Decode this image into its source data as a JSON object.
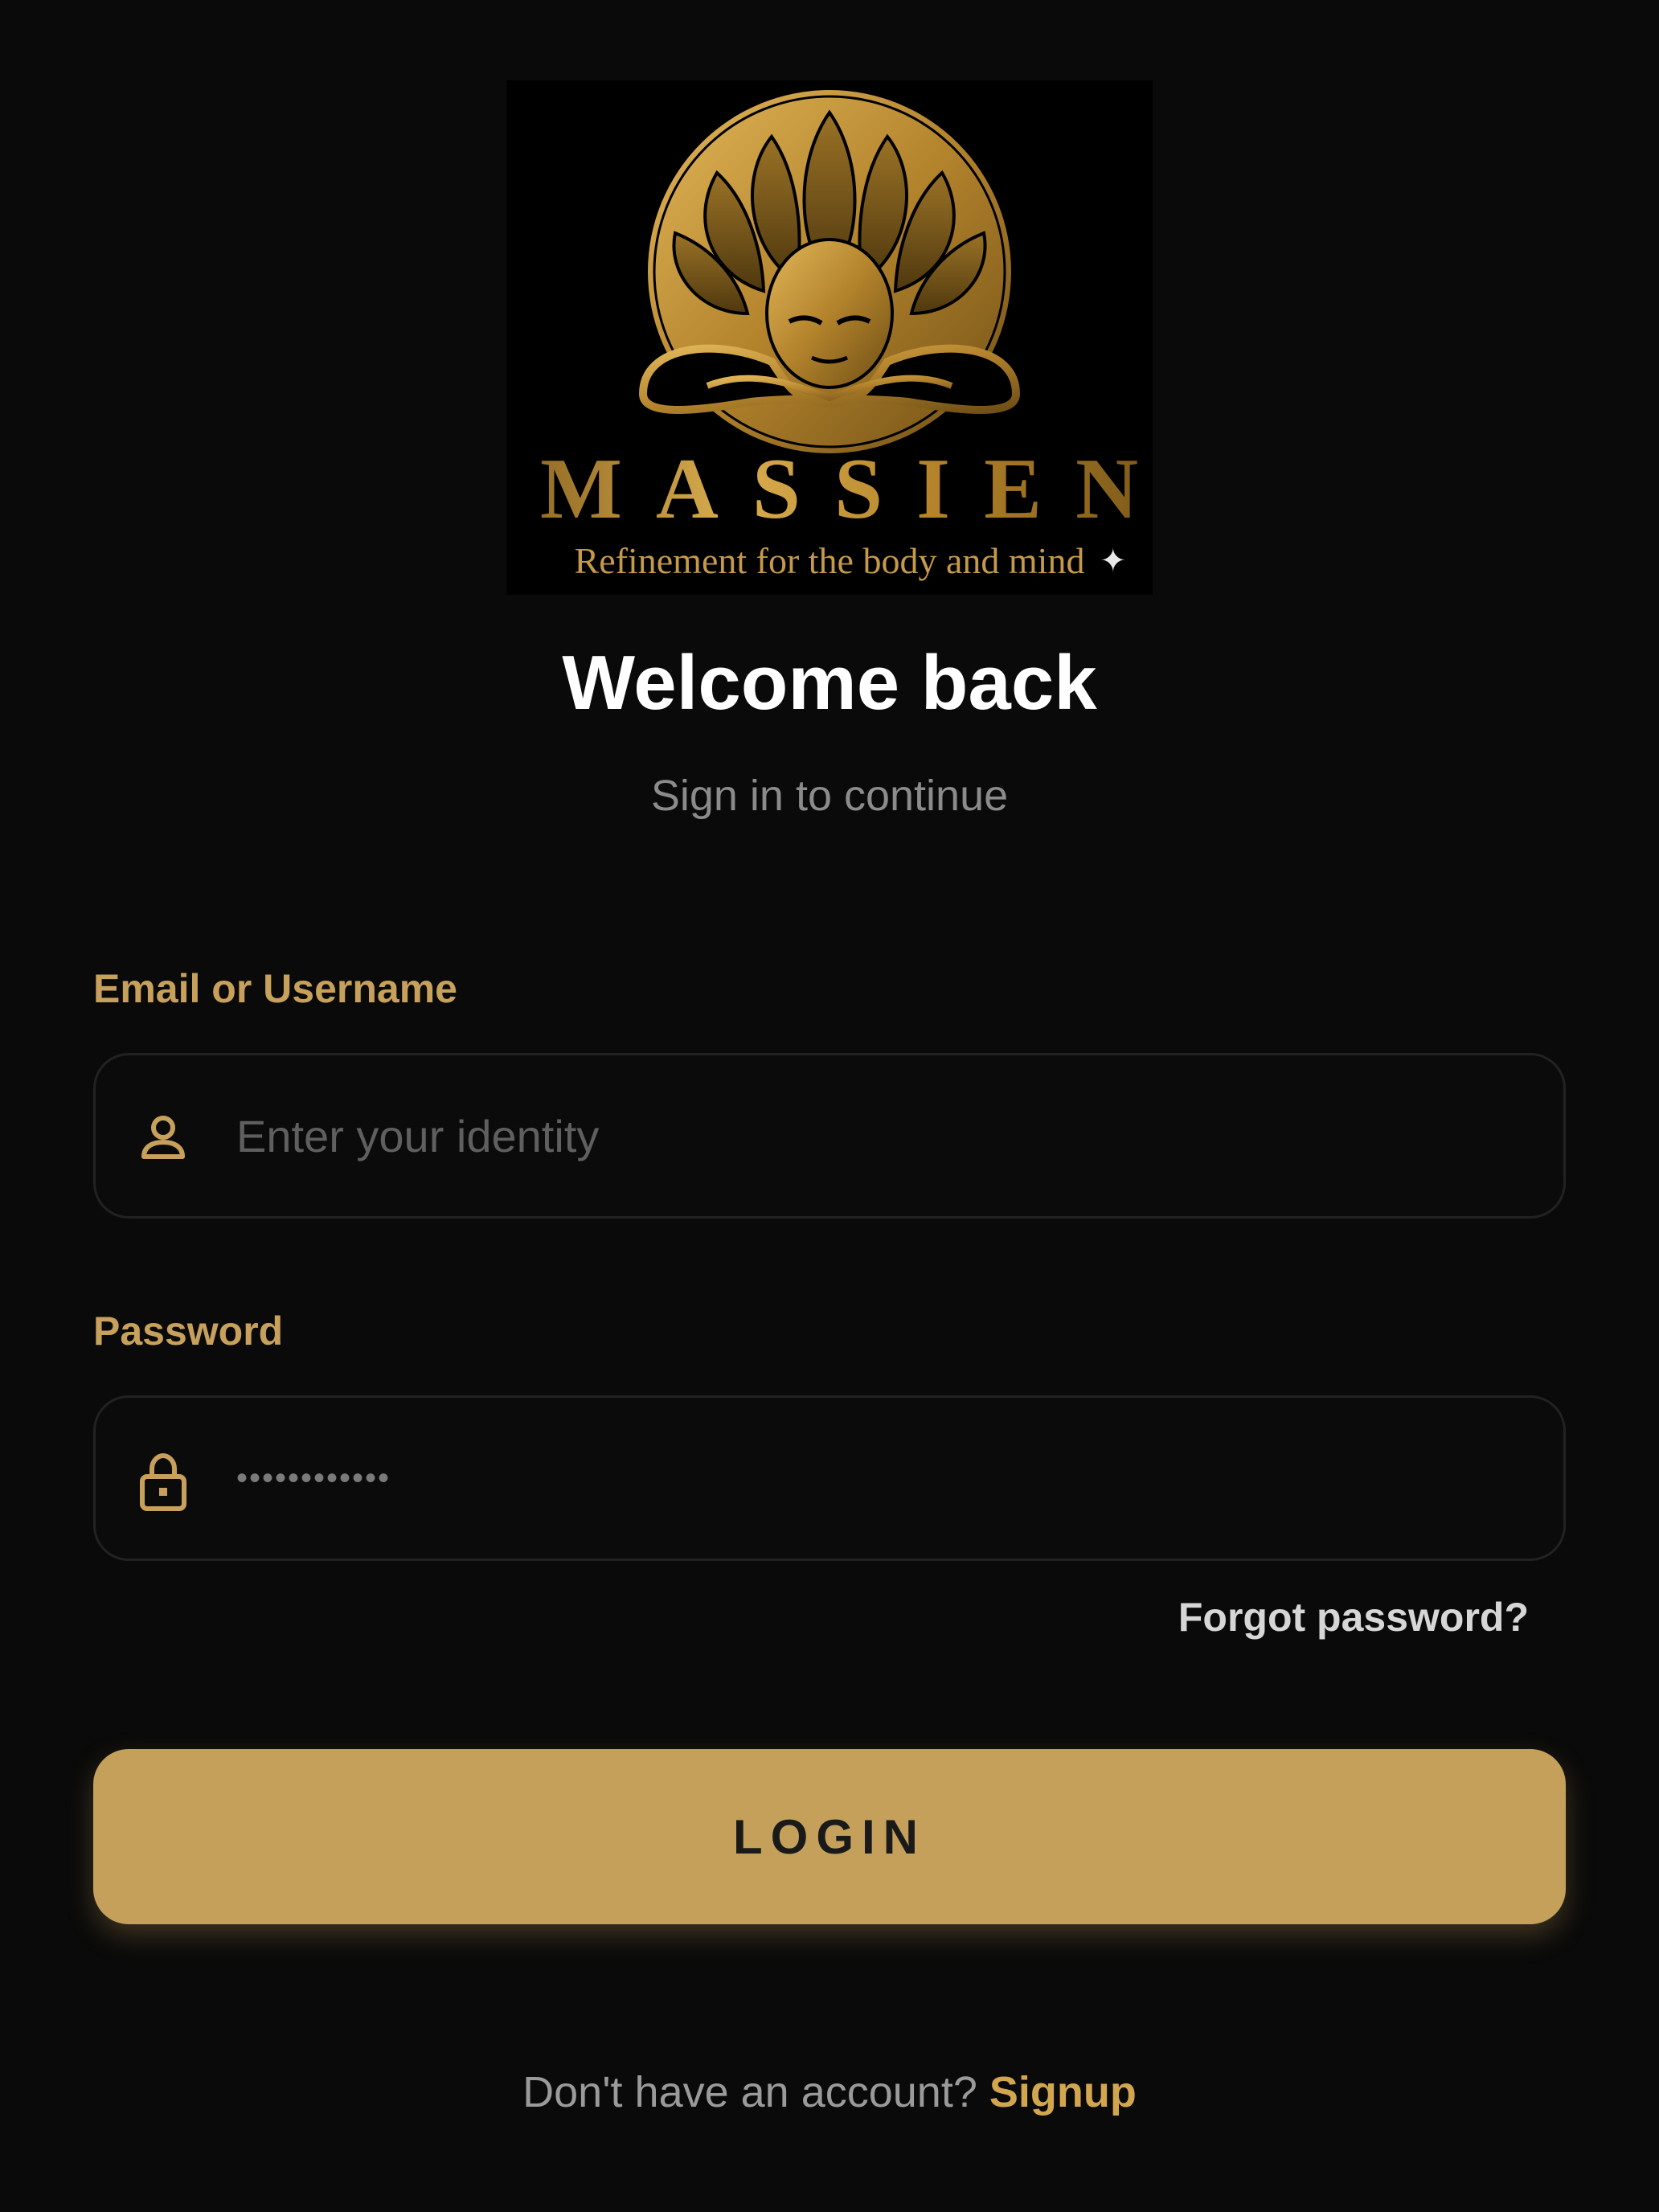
{
  "logo": {
    "brand": "MASSIEN",
    "tagline": "Refinement for the body and mind"
  },
  "header": {
    "title": "Welcome back",
    "subtitle": "Sign in to continue"
  },
  "form": {
    "email_label": "Email or Username",
    "email_placeholder": "Enter your identity",
    "email_value": "",
    "password_label": "Password",
    "password_value": "••••••••••••",
    "forgot_label": "Forgot password?",
    "login_label": "LOGIN"
  },
  "footer": {
    "text": "Don't have an account? ",
    "link": "Signup"
  },
  "icons": {
    "email": "user-icon",
    "password": "lock-icon",
    "sparkle": "sparkle-icon"
  },
  "colors": {
    "background": "#0a0a0a",
    "accent": "#c4a05a",
    "label": "#c7a15b",
    "link": "#d2a64f"
  }
}
